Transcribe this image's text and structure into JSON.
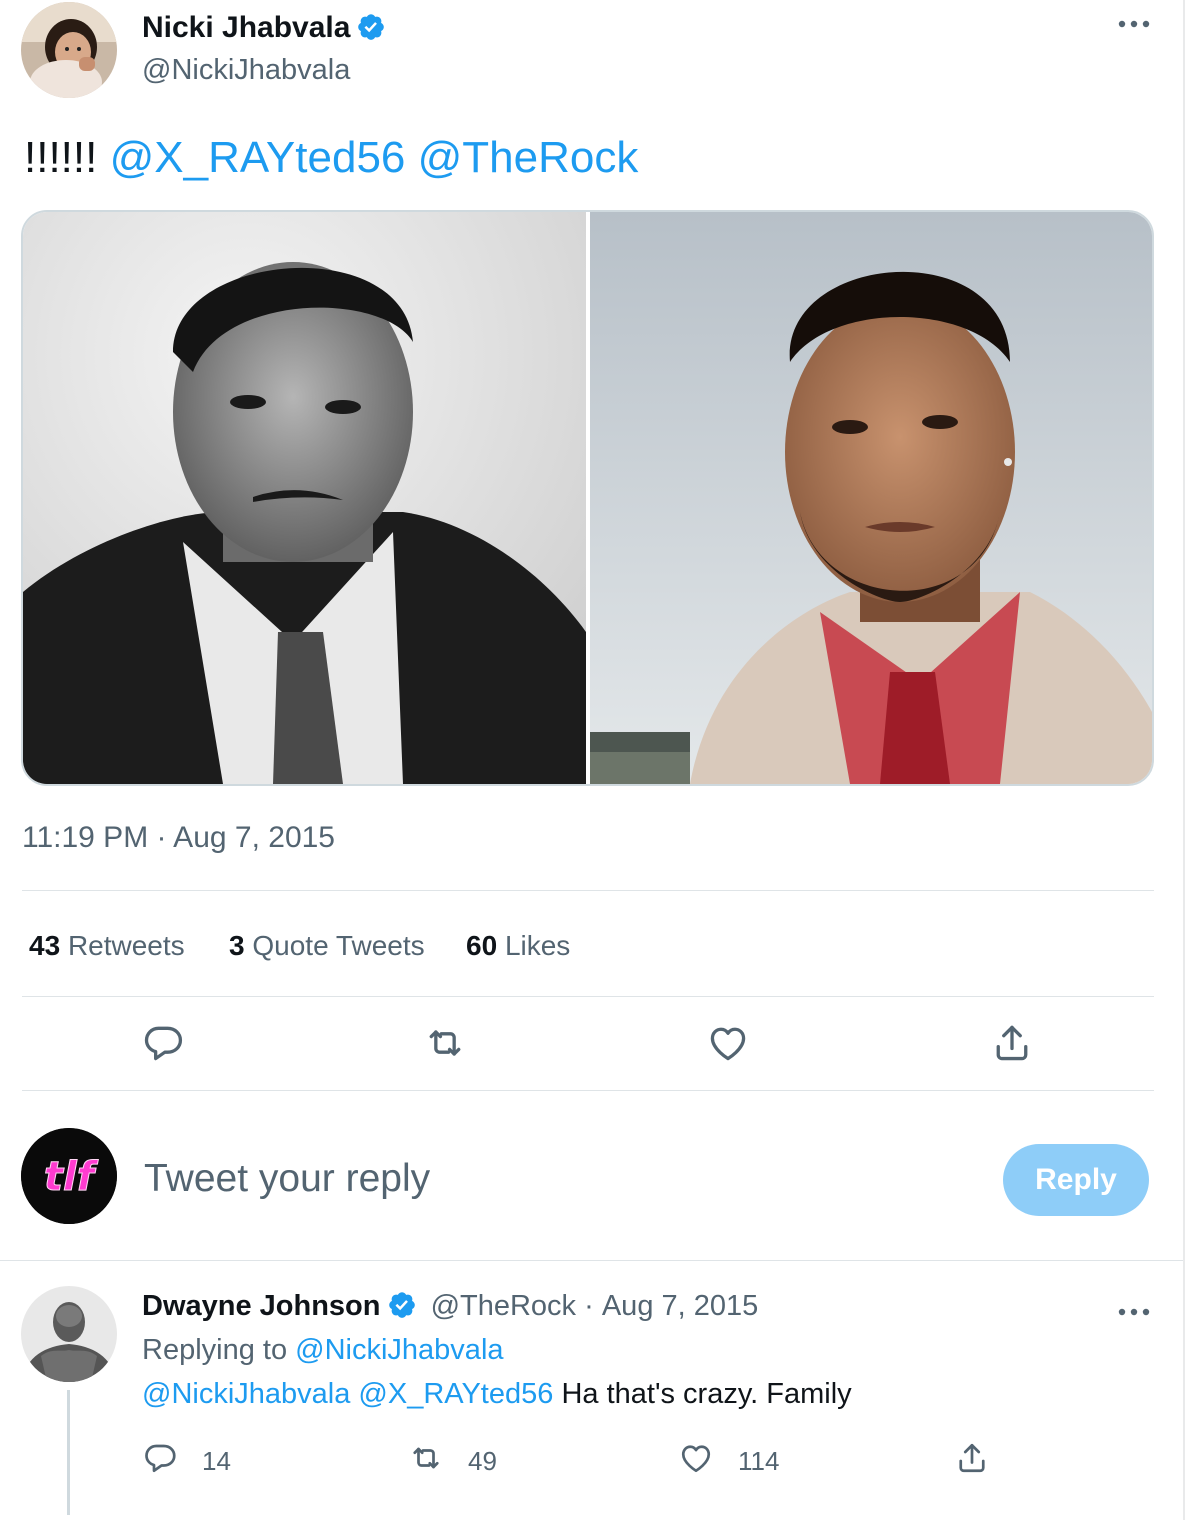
{
  "tweet": {
    "author_name": "Nicki Jhabvala",
    "author_handle": "@NickiJhabvala",
    "text_prefix": "!!!!!!",
    "mention_1": "@X_RAYted56",
    "mention_2": "@TheRock",
    "timestamp": "11:19 PM · Aug 7, 2015",
    "more_icon": "more-dots-icon"
  },
  "stats": {
    "retweets_count": "43",
    "retweets_label": "Retweets",
    "quotes_count": "3",
    "quotes_label": "Quote Tweets",
    "likes_count": "60",
    "likes_label": "Likes"
  },
  "composer": {
    "placeholder": "Tweet your reply",
    "reply_button": "Reply",
    "avatar_text": "tlf"
  },
  "reply": {
    "author_name": "Dwayne Johnson",
    "author_handle": "@TheRock",
    "separator": "·",
    "date": "Aug 7, 2015",
    "replying_to_label": "Replying to",
    "replying_to_handle": "@NickiJhabvala",
    "mention_1": "@NickiJhabvala",
    "mention_2": "@X_RAYted56",
    "text": "Ha that's crazy. Family",
    "reply_count": "14",
    "retweet_count": "49",
    "like_count": "114"
  },
  "colors": {
    "accent": "#1d9bf0",
    "secondary_text": "#536471",
    "reply_button_disabled": "#8ecdf8",
    "tlf_magenta": "#ff3bd0"
  }
}
